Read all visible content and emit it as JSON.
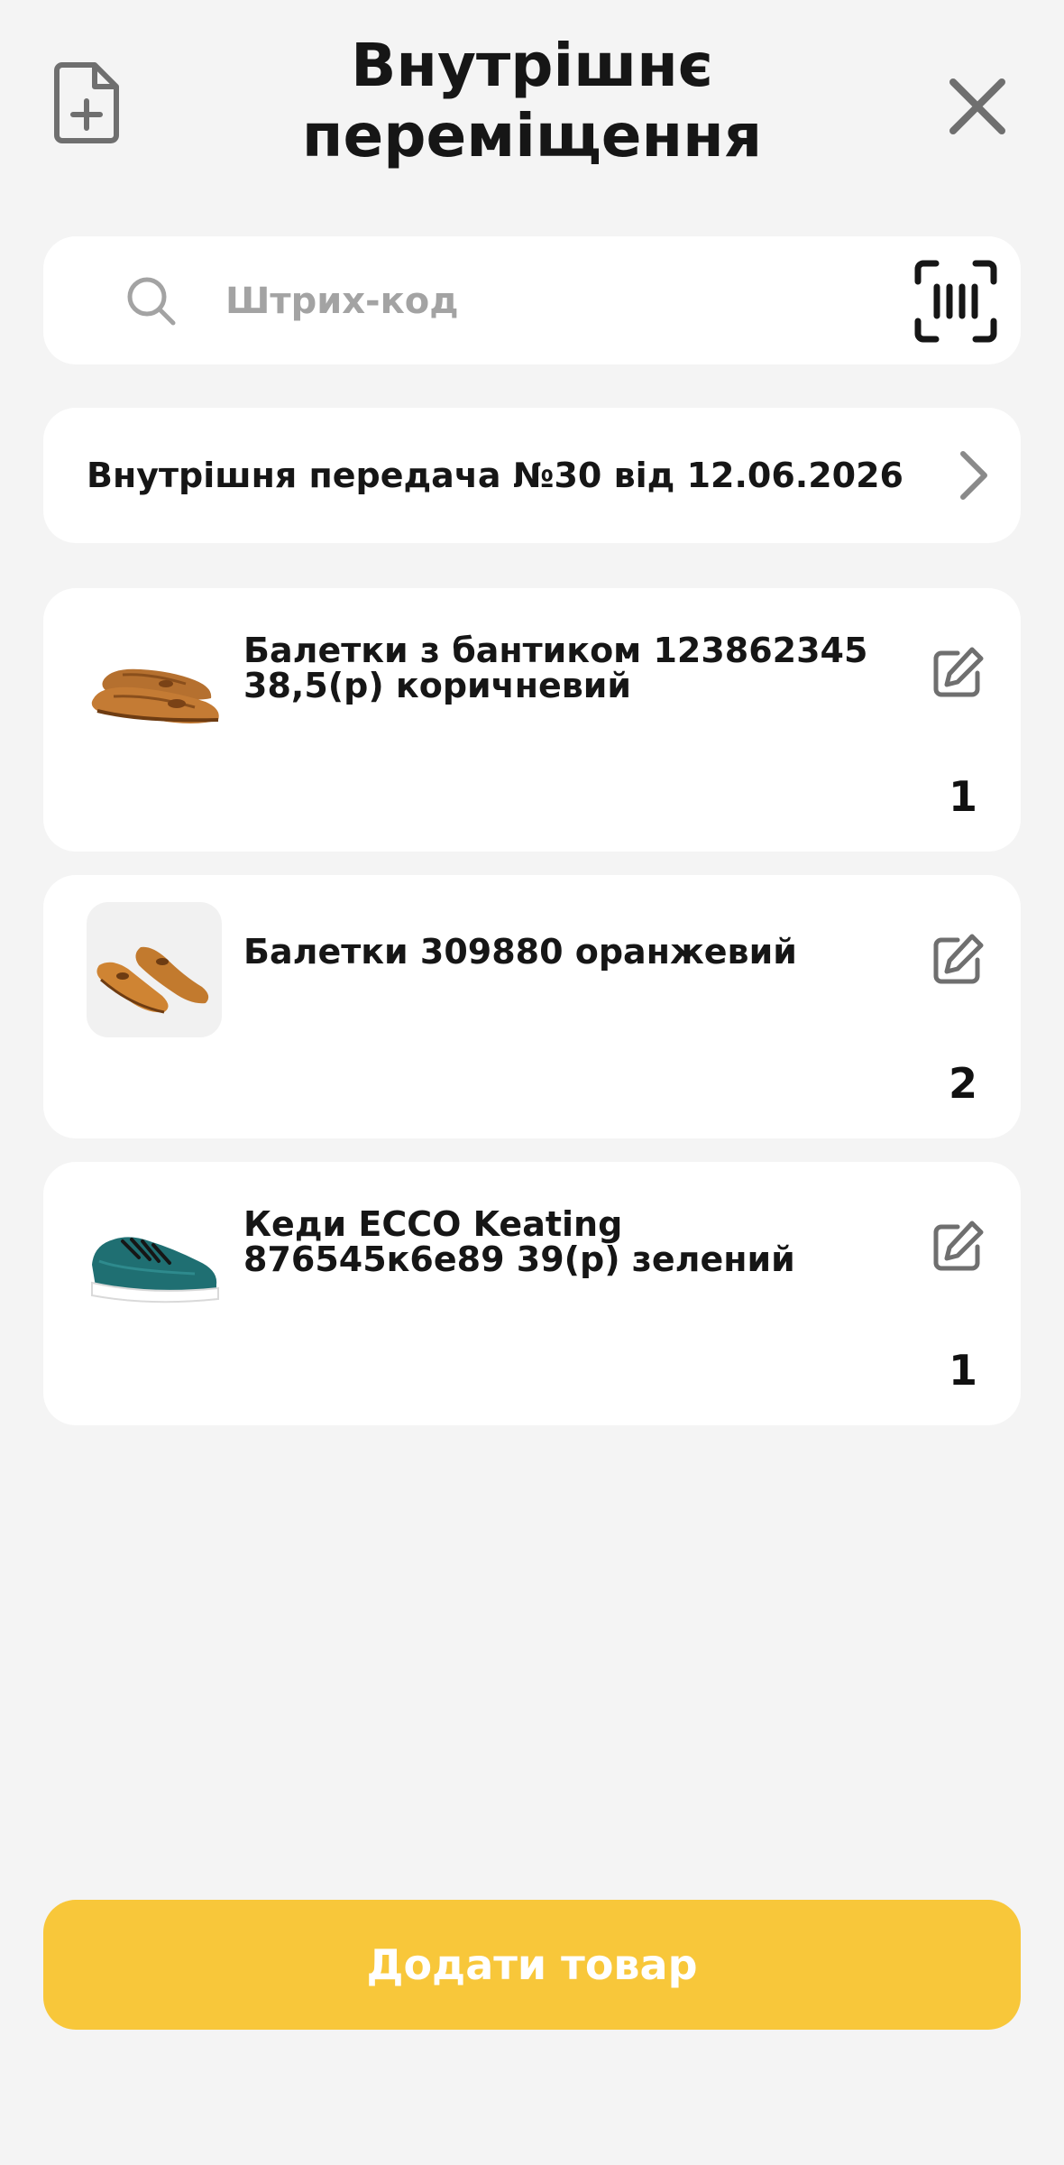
{
  "header": {
    "title_line1": "Внутрішнє",
    "title_line2": "переміщення",
    "new_doc_icon": "file-plus-icon",
    "close_icon": "close-icon"
  },
  "search": {
    "placeholder": "Штрих-код",
    "value": "",
    "icon": "search-icon",
    "scan_icon": "barcode-scan-icon"
  },
  "transfer": {
    "label": "Внутрішня передача №30 від 12.06.2026",
    "icon": "chevron-right-icon"
  },
  "products": [
    {
      "name": "Балетки з бантиком 123862345 38,5(р) коричневий",
      "qty": "1",
      "image": "brown-ballet-flats",
      "edit_icon": "edit-icon"
    },
    {
      "name": "Балетки 309880 оранжевий",
      "qty": "2",
      "image": "orange-ballet-flats",
      "edit_icon": "edit-icon"
    },
    {
      "name": "Кеди ECCO Keating 876545к6е89 39(р) зелений",
      "qty": "1",
      "image": "green-sneaker",
      "edit_icon": "edit-icon"
    }
  ],
  "footer": {
    "add_button_label": "Додати товар"
  },
  "colors": {
    "background": "#f4f4f4",
    "card": "#ffffff",
    "accent": "#f8c73a",
    "icon_gray": "#6f6f6f",
    "placeholder": "#a3a3a3"
  }
}
